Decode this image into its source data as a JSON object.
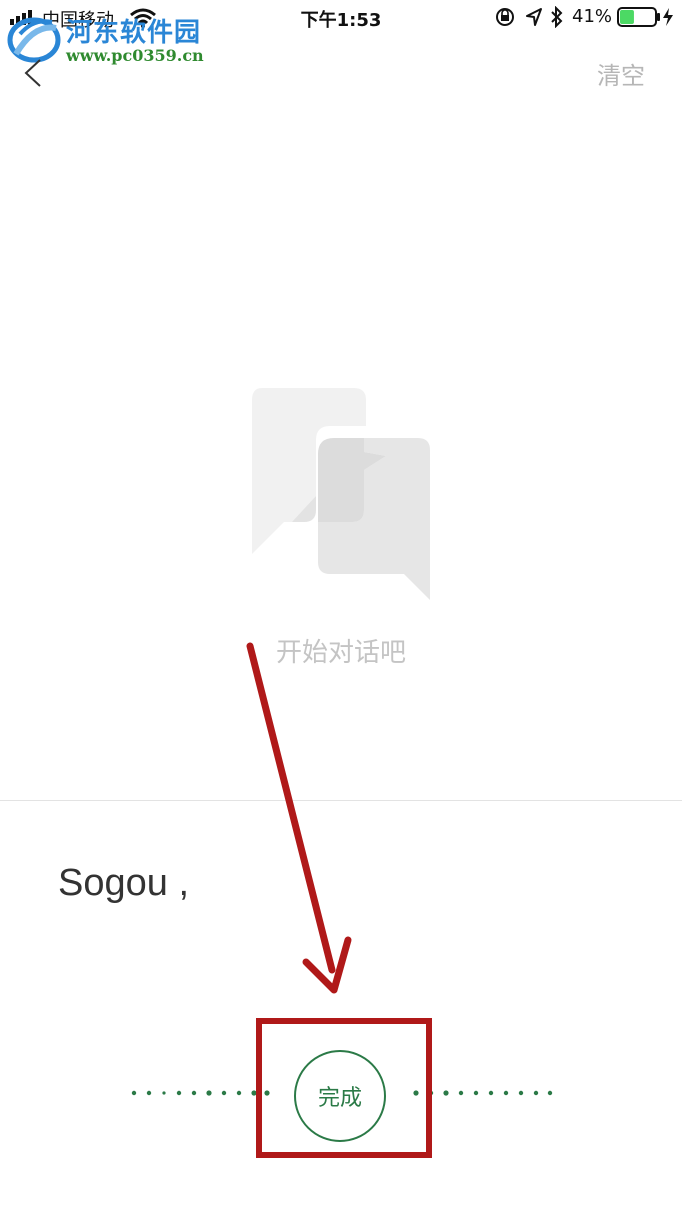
{
  "status_bar": {
    "carrier": "中国移动",
    "time": "下午1:53",
    "battery_percent": "41%",
    "battery_level": 0.41
  },
  "watermark": {
    "title": "河东软件园",
    "url": "www.pc0359.cn"
  },
  "nav": {
    "clear_label": "清空"
  },
  "empty_state": {
    "text": "开始对话吧"
  },
  "recognized_text": "Sogou ,",
  "done_button": {
    "label": "完成"
  },
  "colors": {
    "accent_green": "#2b7a47",
    "annotation_red": "#b01919",
    "muted_gray": "#c4c4c4"
  }
}
